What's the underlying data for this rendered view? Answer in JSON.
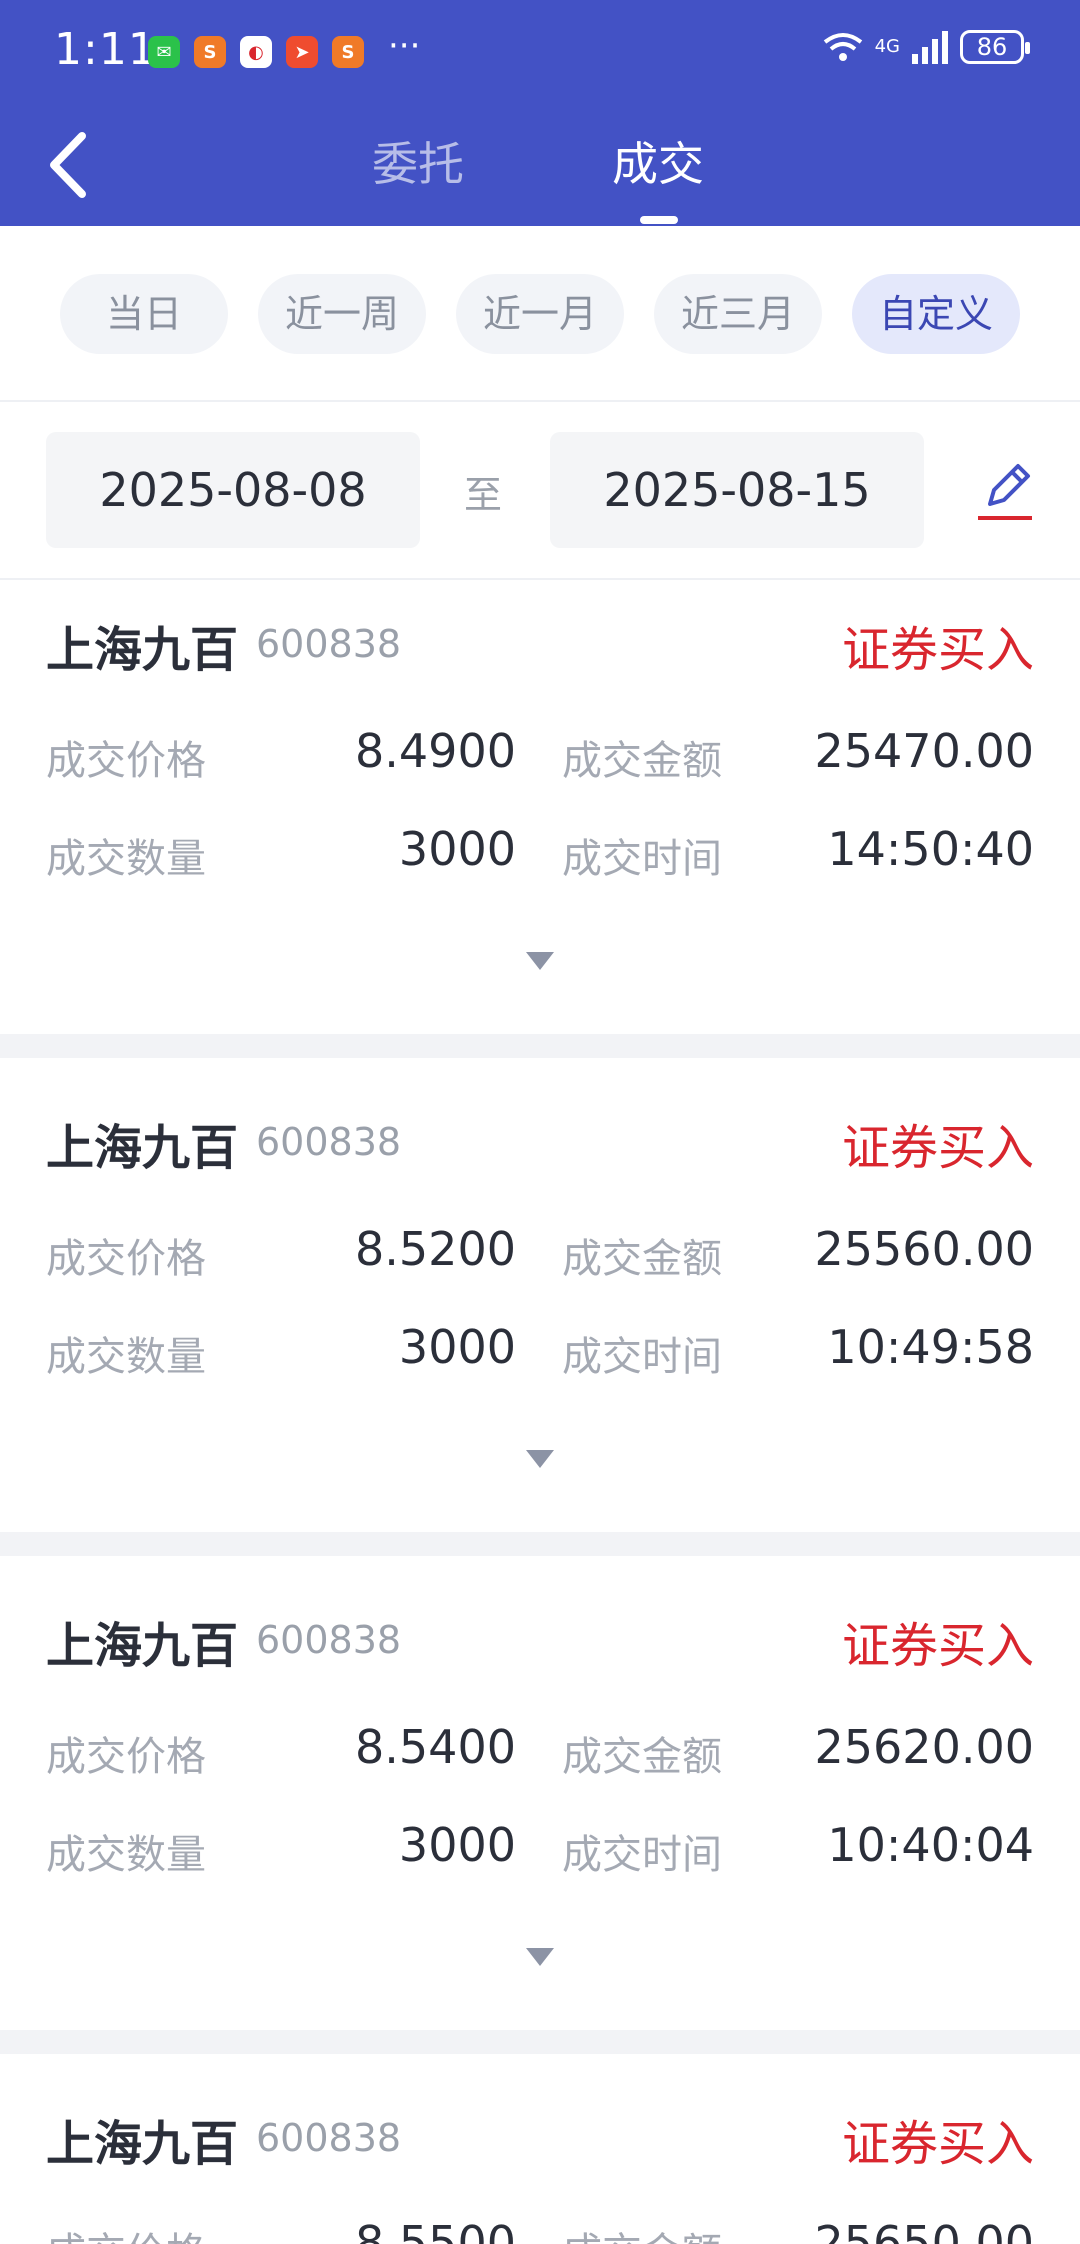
{
  "status_bar": {
    "time": "1:11",
    "more": "···",
    "network": "4G",
    "battery": "86"
  },
  "header": {
    "tabs": [
      {
        "label": "委托",
        "active": false
      },
      {
        "label": "成交",
        "active": true
      }
    ]
  },
  "filters": {
    "chips": [
      {
        "label": "当日",
        "active": false
      },
      {
        "label": "近一周",
        "active": false
      },
      {
        "label": "近一月",
        "active": false
      },
      {
        "label": "近三月",
        "active": false
      },
      {
        "label": "自定义",
        "active": true
      }
    ]
  },
  "date_range": {
    "start": "2025-08-08",
    "separator": "至",
    "end": "2025-08-15"
  },
  "labels": {
    "price": "成交价格",
    "amount": "成交金额",
    "quantity": "成交数量",
    "time": "成交时间"
  },
  "records": [
    {
      "name": "上海九百",
      "code": "600838",
      "type": "证券买入",
      "price": "8.4900",
      "amount": "25470.00",
      "quantity": "3000",
      "time": "14:50:40"
    },
    {
      "name": "上海九百",
      "code": "600838",
      "type": "证券买入",
      "price": "8.5200",
      "amount": "25560.00",
      "quantity": "3000",
      "time": "10:49:58"
    },
    {
      "name": "上海九百",
      "code": "600838",
      "type": "证券买入",
      "price": "8.5400",
      "amount": "25620.00",
      "quantity": "3000",
      "time": "10:40:04"
    },
    {
      "name": "上海九百",
      "code": "600838",
      "type": "证券买入",
      "price": "8.5500",
      "amount": "25650.00",
      "quantity": "",
      "time": ""
    }
  ],
  "colors": {
    "header_bg": "#4352c5",
    "buy_red": "#d9262e",
    "active_chip": "#3b47b3"
  }
}
